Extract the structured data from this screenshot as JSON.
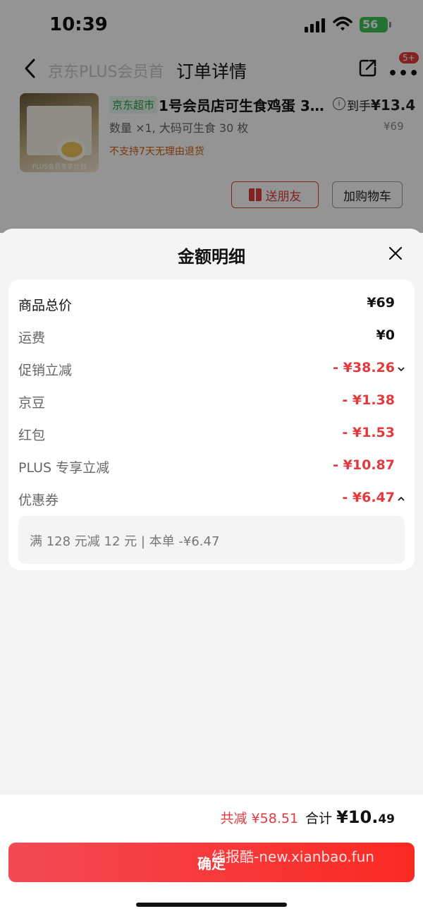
{
  "status_bar": {
    "time": "10:39",
    "battery": "56"
  },
  "nav": {
    "title": "订单详情",
    "faded_subtitle": "京东PLUS会员首",
    "badge": "5+"
  },
  "product": {
    "store_tag": "京东超市",
    "name": "1号会员店可生食鸡蛋 3…",
    "final_price_label": "到手",
    "final_price": "¥13.4",
    "spec": "数量 ×1, 大码可生食 30 枚",
    "original_price": "¥69",
    "return_notice": "不支持7天无理由退货",
    "thumb_caption": "PLUS会员专享计划",
    "gift_button": "送朋友",
    "cart_button": "加购物车"
  },
  "sheet": {
    "title": "金额明细",
    "rows": [
      {
        "label": "商品总价",
        "value": "¥69"
      },
      {
        "label": "运费",
        "value": "¥0"
      },
      {
        "label": "促销立减",
        "value": "- ¥38.26"
      },
      {
        "label": "京豆",
        "value": "- ¥1.38"
      },
      {
        "label": "红包",
        "value": "- ¥1.53"
      },
      {
        "label": "PLUS 专享立减",
        "value": "- ¥10.87"
      },
      {
        "label": "优惠券",
        "value": "- ¥6.47"
      }
    ],
    "coupon_detail": "满 128 元减 12 元 | 本单 -¥6.47"
  },
  "footer": {
    "saved": "共减 ¥58.51",
    "total_label": "合计",
    "total_int": "¥10.",
    "total_dec": "49",
    "confirm_button": "确定",
    "watermark": "线报酷-new.xianbao.fun"
  },
  "colors": {
    "accent_red": "#e4393c",
    "store_green": "#2a9d4a",
    "battery_green": "#3ec35a"
  }
}
